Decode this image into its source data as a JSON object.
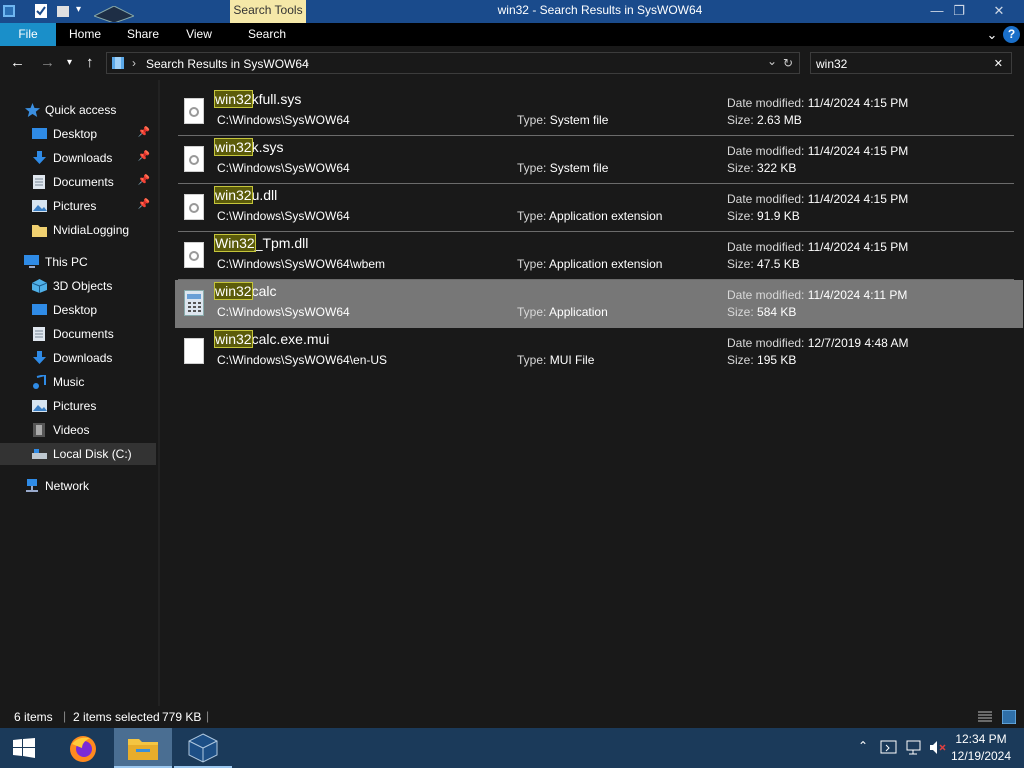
{
  "window": {
    "title": "win32 - Search Results in SysWOW64",
    "context_tab": "Search Tools",
    "minimize": "—",
    "maximize": "❐",
    "close": "✕"
  },
  "ribbon": {
    "tabs": [
      "File",
      "Home",
      "Share",
      "View",
      "Search"
    ],
    "collapse": "⌄",
    "help": "?"
  },
  "address": {
    "breadcrumb_sep": "›",
    "location": "Search Results in SysWOW64",
    "trailing_sep": "›",
    "dropdown": "⌄",
    "refresh": "↻"
  },
  "search": {
    "value": "win32",
    "clear": "✕"
  },
  "nav_pane": {
    "quick_access": "Quick access",
    "quick_items": [
      {
        "label": "Desktop",
        "pinned": true
      },
      {
        "label": "Downloads",
        "pinned": true
      },
      {
        "label": "Documents",
        "pinned": true
      },
      {
        "label": "Pictures",
        "pinned": true
      },
      {
        "label": "NvidiaLogging",
        "pinned": false
      }
    ],
    "this_pc": "This PC",
    "pc_items": [
      "3D Objects",
      "Desktop",
      "Documents",
      "Downloads",
      "Music",
      "Pictures",
      "Videos",
      "Local Disk (C:)"
    ],
    "network": "Network"
  },
  "results": [
    {
      "match": "win32",
      "rest": "kfull.sys",
      "path": "C:\\Windows\\SysWOW64",
      "type_label": "Type:",
      "type": "System file",
      "date_label": "Date modified:",
      "date": "11/4/2024 4:15 PM",
      "size_label": "Size:",
      "size": "2.63 MB",
      "selected": false
    },
    {
      "match": "win32",
      "rest": "k.sys",
      "path": "C:\\Windows\\SysWOW64",
      "type_label": "Type:",
      "type": "System file",
      "date_label": "Date modified:",
      "date": "11/4/2024 4:15 PM",
      "size_label": "Size:",
      "size": "322 KB",
      "selected": false
    },
    {
      "match": "win32",
      "rest": "u.dll",
      "path": "C:\\Windows\\SysWOW64",
      "type_label": "Type:",
      "type": "Application extension",
      "date_label": "Date modified:",
      "date": "11/4/2024 4:15 PM",
      "size_label": "Size:",
      "size": "91.9 KB",
      "selected": false
    },
    {
      "match": "Win32",
      "rest": "_Tpm.dll",
      "path": "C:\\Windows\\SysWOW64\\wbem",
      "type_label": "Type:",
      "type": "Application extension",
      "date_label": "Date modified:",
      "date": "11/4/2024 4:15 PM",
      "size_label": "Size:",
      "size": "47.5 KB",
      "selected": false
    },
    {
      "match": "win32",
      "rest": "calc",
      "path": "C:\\Windows\\SysWOW64",
      "type_label": "Type:",
      "type": "Application",
      "date_label": "Date modified:",
      "date": "11/4/2024 4:11 PM",
      "size_label": "Size:",
      "size": "584 KB",
      "selected": true
    },
    {
      "match": "win32",
      "rest": "calc.exe.mui",
      "path": "C:\\Windows\\SysWOW64\\en-US",
      "type_label": "Type:",
      "type": "MUI File",
      "date_label": "Date modified:",
      "date": "12/7/2019 4:48 AM",
      "size_label": "Size:",
      "size": "195 KB",
      "selected": false
    }
  ],
  "status": {
    "items_count": "6 items",
    "selected": "2 items selected",
    "selected_size": "779 KB"
  },
  "taskbar": {
    "apps": [
      "start-icon",
      "firefox-icon",
      "file-explorer-icon",
      "virtualbox-icon"
    ],
    "time": "12:34 PM",
    "date": "12/19/2024"
  },
  "colors": {
    "accent": "#1a8fc9",
    "titlebar": "#1a4b8c",
    "context_tab": "#f5e8a8",
    "highlight": "#5b5b0a",
    "selection": "#777777",
    "taskbar": "#1b3a5a"
  }
}
